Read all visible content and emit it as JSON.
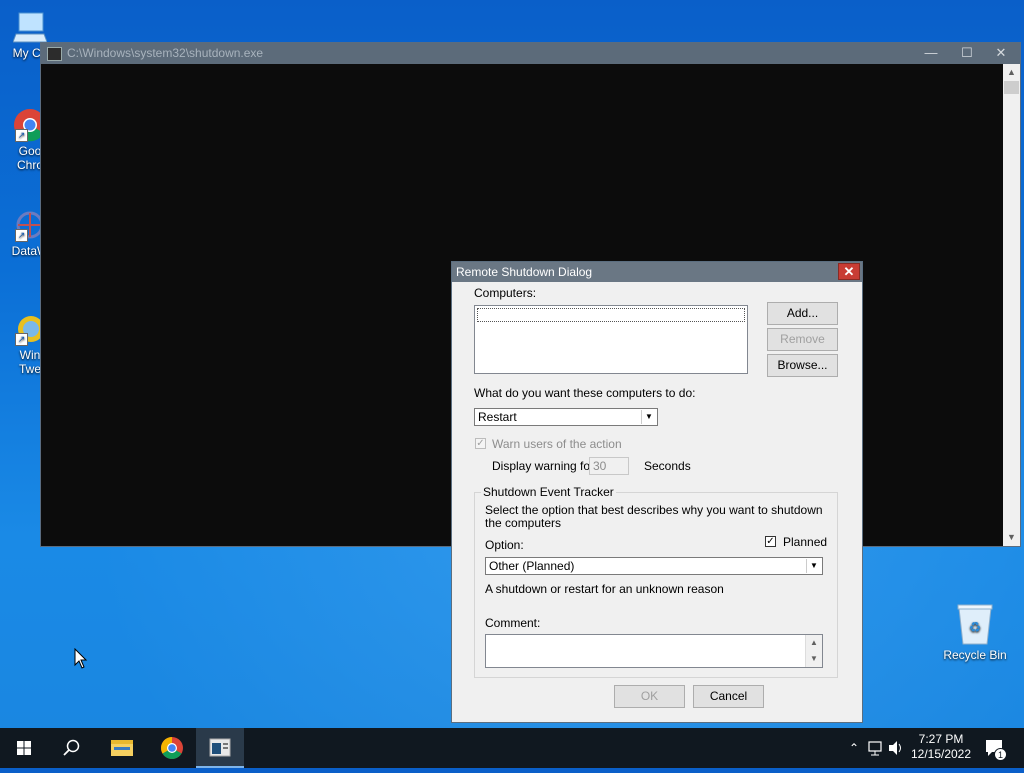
{
  "desktop": {
    "icons": [
      {
        "label": "My Co",
        "icon": "computer-icon"
      },
      {
        "label": "Goo Chro",
        "icon": "chrome-icon"
      },
      {
        "label": "DataW",
        "icon": "datawrapper-icon"
      },
      {
        "label": "Win Twe",
        "icon": "winaero-icon"
      },
      {
        "label": "Recycle Bin",
        "icon": "recycle-bin-icon"
      }
    ],
    "icon_lines": {
      "mycomputer": "My Co",
      "chrome_1": "Goo",
      "chrome_2": "Chro",
      "dataw": "DataW",
      "win_1": "Win",
      "win_2": "Twe",
      "recycle": "Recycle Bin"
    }
  },
  "console": {
    "title": "C:\\Windows\\system32\\shutdown.exe",
    "min_glyph": "—",
    "max_glyph": "☐",
    "close_glyph": "✕"
  },
  "dialog": {
    "title": "Remote Shutdown Dialog",
    "close_glyph": "✕",
    "computers_label": "Computers:",
    "add_button": "Add...",
    "remove_button": "Remove",
    "browse_button": "Browse...",
    "action_question": "What do you want these computers to do:",
    "action_value": "Restart",
    "warn_label": "Warn users of the action",
    "display_warning_label": "Display warning for",
    "seconds_value": "30",
    "seconds_label": "Seconds",
    "tracker_title": "Shutdown Event Tracker",
    "tracker_desc": "Select the option that best describes why you want to shutdown the computers",
    "option_label": "Option:",
    "planned_label": "Planned",
    "option_value": "Other (Planned)",
    "reason_text": "A shutdown or restart for an unknown reason",
    "comment_label": "Comment:",
    "ok_button": "OK",
    "cancel_button": "Cancel"
  },
  "taskbar": {
    "time": "7:27 PM",
    "date": "12/15/2022",
    "notification_count": "1"
  },
  "colors": {
    "accent": "#0b6fd6",
    "dialog_title": "#6a7784",
    "close_red": "#c83c34",
    "taskbar": "#101820"
  }
}
